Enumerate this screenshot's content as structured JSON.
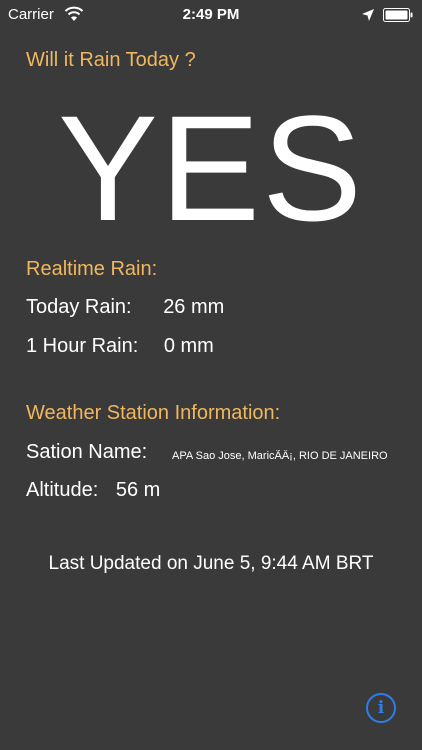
{
  "status_bar": {
    "carrier": "Carrier",
    "time": "2:49 PM",
    "icons": [
      "wifi-icon",
      "location-arrow-icon",
      "battery-icon"
    ]
  },
  "question": "Will it Rain Today ?",
  "answer": "YES",
  "realtime": {
    "title": "Realtime Rain:",
    "today_label": "Today Rain:",
    "today_value": "26 mm",
    "hour_label": "1 Hour Rain:",
    "hour_value": "0 mm"
  },
  "station": {
    "title": "Weather Station Information:",
    "name_label": "Sation Name:",
    "name_value": "APA Sao Jose, MaricÃÂ¡, RIO DE JANEIRO",
    "altitude_label": "Altitude:",
    "altitude_value": "56 m"
  },
  "last_updated": "Last Updated on June 5, 9:44 AM BRT",
  "colors": {
    "background": "#3a3a3a",
    "accent": "#f0b75f",
    "info_button": "#2f7de8"
  }
}
